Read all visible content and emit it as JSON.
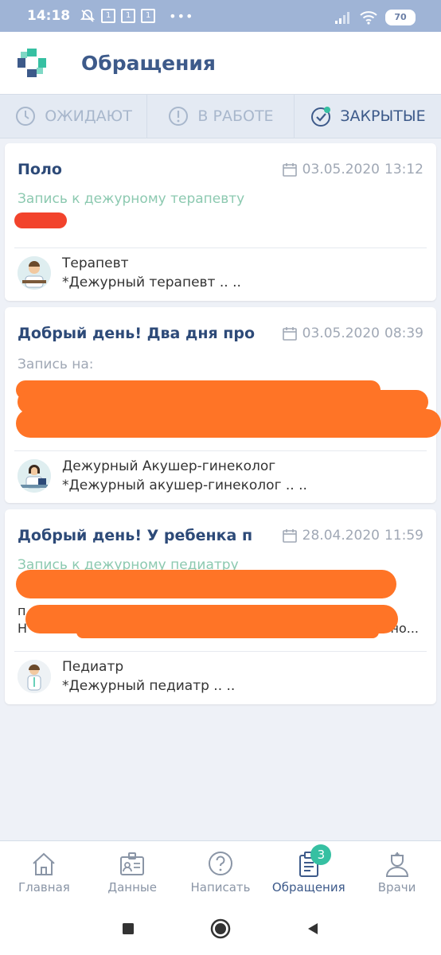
{
  "status": {
    "time": "14:18",
    "box_label": "1",
    "dots": "•••",
    "battery": "70"
  },
  "header": {
    "title": "Обращения"
  },
  "tabs": [
    {
      "label": "ОЖИДАЮТ",
      "icon": "clock-icon"
    },
    {
      "label": "В РАБОТЕ",
      "icon": "exclamation-circle-icon"
    },
    {
      "label": "ЗАКРЫТЫЕ",
      "icon": "check-circle-icon",
      "active": true
    }
  ],
  "cards": [
    {
      "title": "Поло",
      "date": "03.05.2020",
      "time": "13:12",
      "subtitle": "Запись к дежурному терапевту",
      "doctor_role": "Терапевт",
      "doctor_desc": "*Дежурный терапевт .. .."
    },
    {
      "title": "Добрый день! Два дня про",
      "date": "03.05.2020",
      "time": "08:39",
      "subtitle": "Запись на:",
      "doctor_role": "Дежурный Акушер-гинеколог",
      "doctor_desc": "*Дежурный акушер-гинеколог .. .."
    },
    {
      "title": "Добрый день! У ребенка п",
      "date": "28.04.2020",
      "time": "11:59",
      "subtitle": "Запись к дежурному педиатру",
      "line_tail": "но...",
      "line_start_1": "п",
      "line_start_2": "Н",
      "doctor_role": "Педиатр",
      "doctor_desc": "*Дежурный педиатр .. .."
    }
  ],
  "nav": [
    {
      "label": "Главная",
      "icon": "home-icon"
    },
    {
      "label": "Данные",
      "icon": "id-card-icon"
    },
    {
      "label": "Написать",
      "icon": "question-bubble-icon"
    },
    {
      "label": "Обращения",
      "icon": "clipboard-icon",
      "active": true,
      "badge": "3"
    },
    {
      "label": "Врачи",
      "icon": "doctor-icon"
    }
  ],
  "colors": {
    "accent": "#3d5a8a",
    "green": "#36c0a2",
    "redact_orange": "#ff7426",
    "redact_red": "#f2432c"
  }
}
